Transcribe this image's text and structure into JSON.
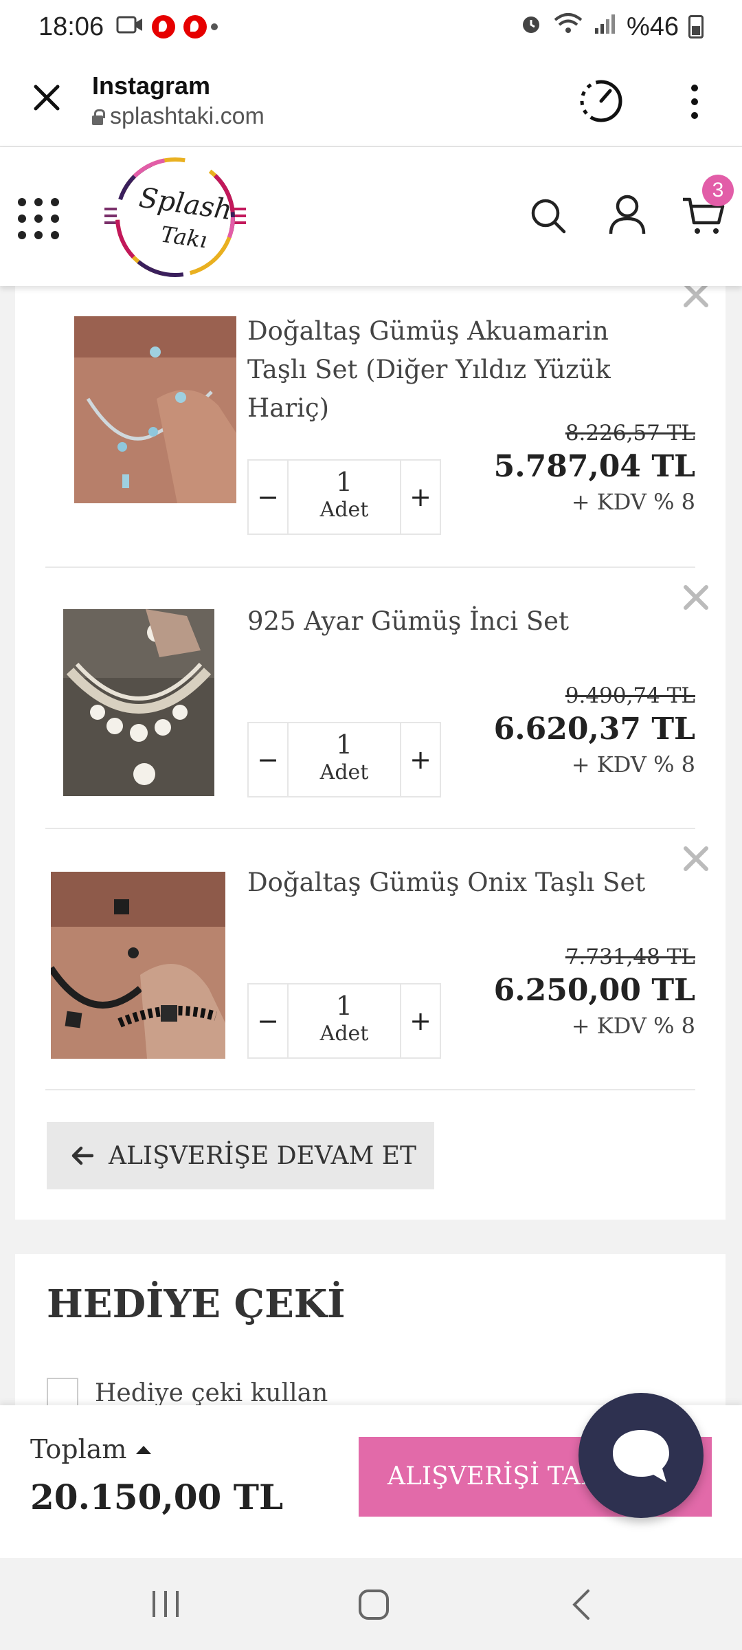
{
  "status_bar": {
    "time": "18:06",
    "battery": "%46"
  },
  "browser": {
    "title": "Instagram",
    "url": "splashtaki.com"
  },
  "site": {
    "logo_line1": "Splash",
    "logo_line2": "Takı",
    "cart_count": "3"
  },
  "cart": {
    "items": [
      {
        "name": "Doğaltaş Gümüş Akuamarin Taşlı Set (Diğer Yıldız Yüzük Hariç)",
        "quantity": "1",
        "unit": "Adet",
        "old_price": "8.226,57 TL",
        "price": "5.787,04 TL",
        "vat": "+ KDV % 8"
      },
      {
        "name": "925 Ayar Gümüş İnci Set",
        "quantity": "1",
        "unit": "Adet",
        "old_price": "9.490,74 TL",
        "price": "6.620,37 TL",
        "vat": "+ KDV % 8"
      },
      {
        "name": "Doğaltaş Gümüş Onix Taşlı Set",
        "quantity": "1",
        "unit": "Adet",
        "old_price": "7.731,48 TL",
        "price": "6.250,00 TL",
        "vat": "+ KDV % 8"
      }
    ],
    "continue_label": "ALIŞVERİŞE DEVAM ET",
    "minus": "−",
    "plus": "+"
  },
  "gift": {
    "title": "HEDİYE ÇEKİ",
    "checkbox_label": "Hediye çeki kullan"
  },
  "checkout": {
    "total_label": "Toplam",
    "total_value": "20.150,00 TL",
    "button_label": "ALIŞVERİŞİ TAMAMLA"
  },
  "colors": {
    "accent": "#e26aa9",
    "badge": "#e25da8",
    "chat": "#2e3150"
  }
}
